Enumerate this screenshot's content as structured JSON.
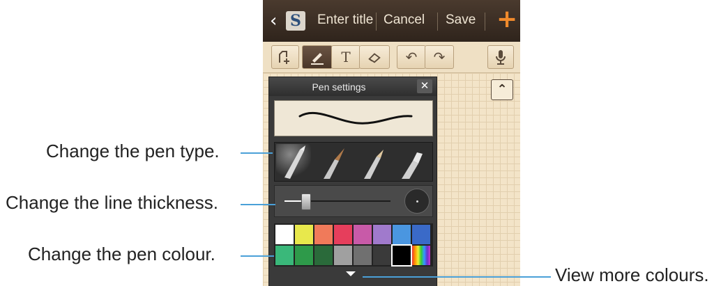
{
  "topbar": {
    "back": "‹",
    "logo": "S",
    "title_placeholder": "Enter title",
    "cancel": "Cancel",
    "save": "Save",
    "add": "+"
  },
  "toolbar": {
    "icons": [
      "select-area-icon",
      "pen-icon",
      "text-icon",
      "eraser-icon",
      "undo-icon",
      "redo-icon",
      "microphone-icon"
    ]
  },
  "panel": {
    "title": "Pen settings",
    "close": "✕",
    "thickness_fraction": 0.2,
    "colors_row1": [
      "#ffffff",
      "#e8e84c",
      "#f07a5a",
      "#e63e5c",
      "#c85aa8",
      "#a07acc",
      "#4a96e0",
      "#3a6ac8"
    ],
    "colors_row2": [
      "#3ab87a",
      "#2e9a4a",
      "#2a6a3a",
      "#a0a0a0",
      "#707070",
      "#3a3a3a",
      "#000000",
      "rainbow"
    ]
  },
  "callouts": {
    "pen_type": "Change the pen type.",
    "thickness": "Change the line thickness.",
    "pen_colour": "Change the pen colour.",
    "more_colours": "View more colours."
  },
  "colors": {
    "callout_line": "#4aa0d8",
    "accent": "#f08a2c"
  }
}
